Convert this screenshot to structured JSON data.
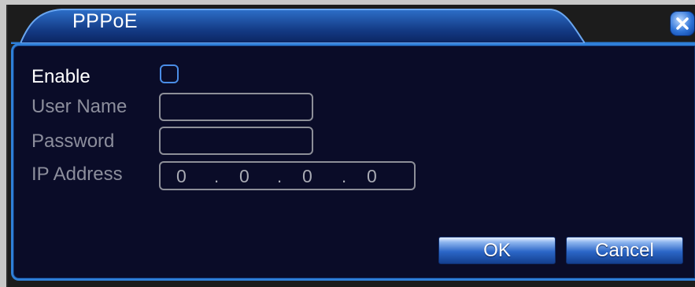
{
  "dialog": {
    "title": "PPPoE",
    "close_icon": "close-x-icon"
  },
  "form": {
    "enable_label": "Enable",
    "enable_checked": false,
    "username_label": "User Name",
    "username_value": "",
    "password_label": "Password",
    "password_value": "",
    "ip_label": "IP Address",
    "ip_octets": [
      "0",
      "0",
      "0",
      "0"
    ]
  },
  "buttons": {
    "ok_label": "OK",
    "cancel_label": "Cancel"
  },
  "colors": {
    "panel_background": "#0a0c28",
    "accent_blue": "#2f7fd8",
    "label_gray": "#8c8e9c"
  }
}
